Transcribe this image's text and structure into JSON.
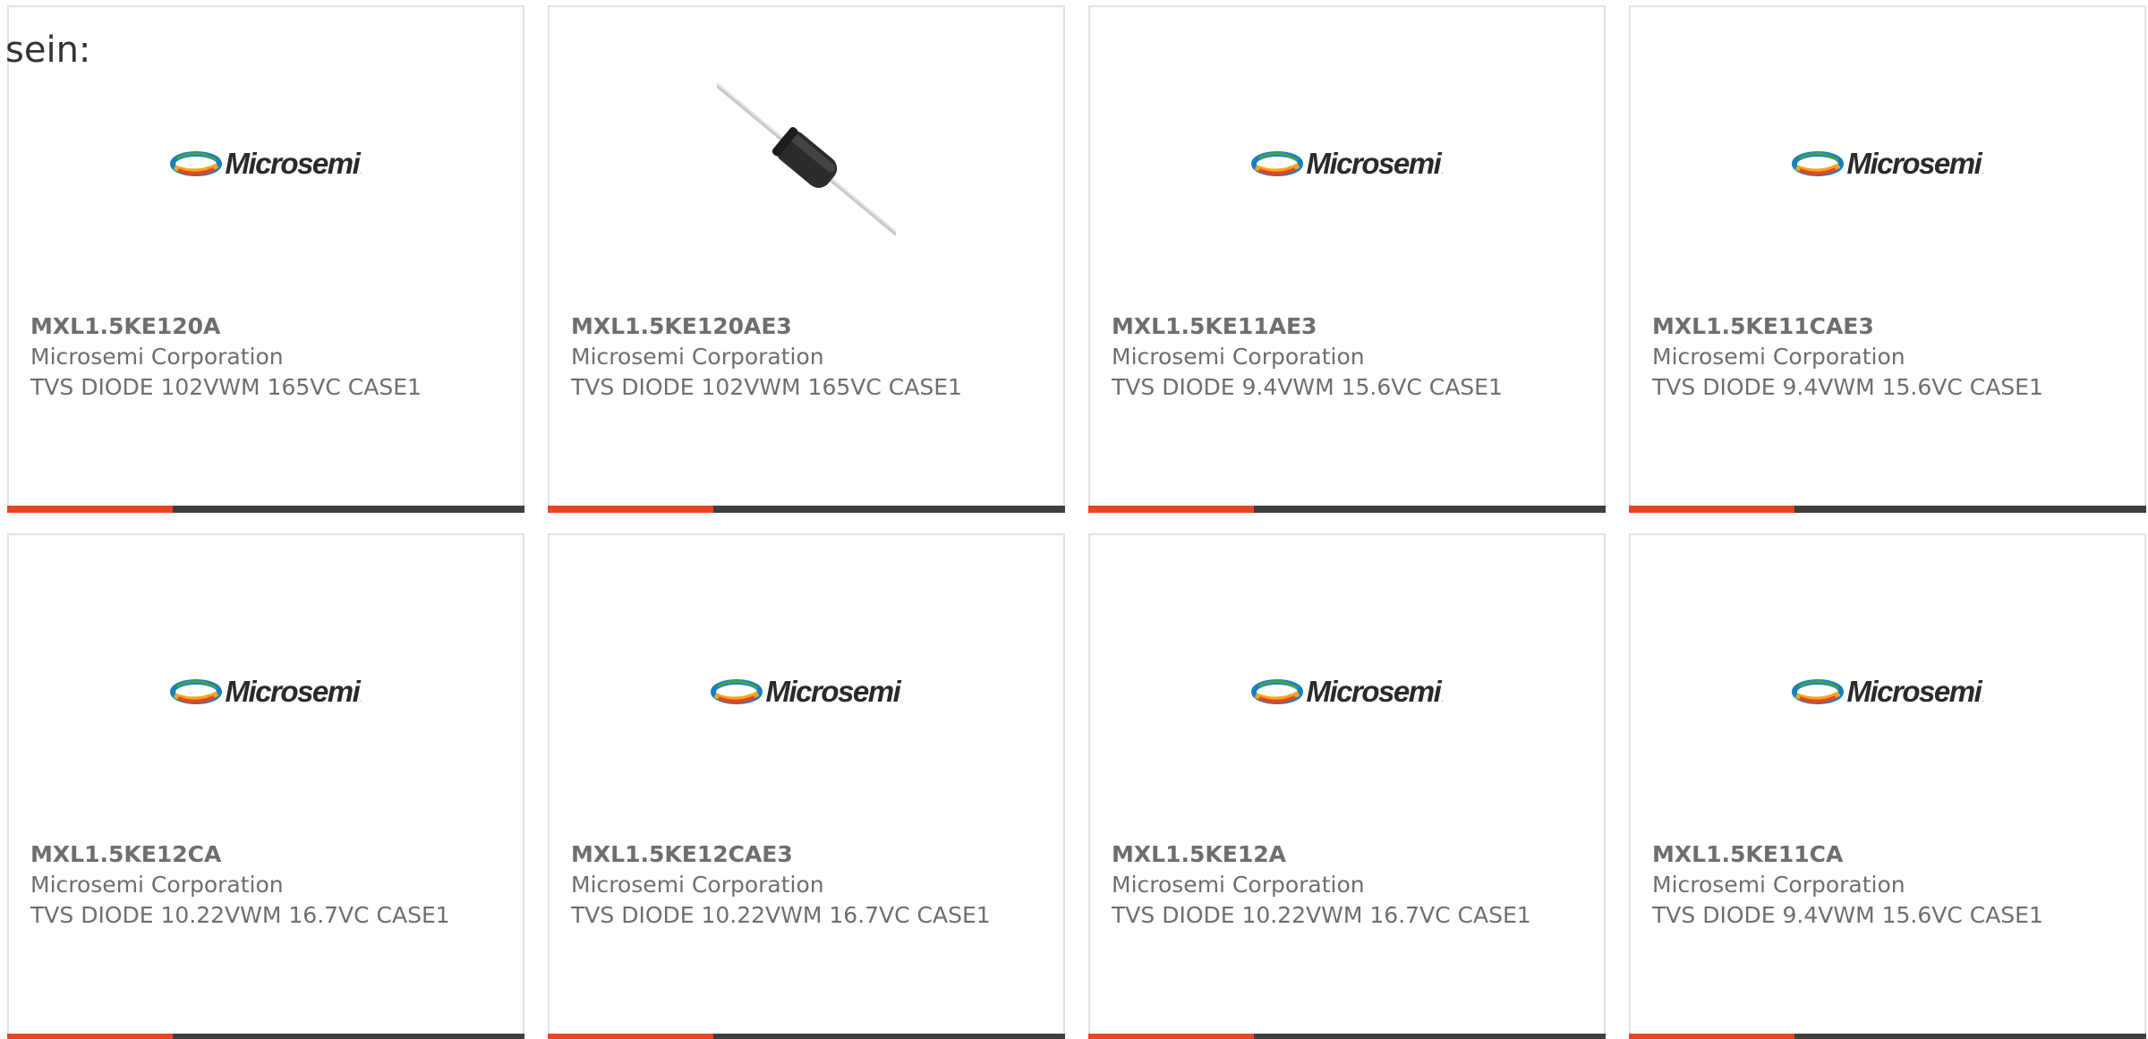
{
  "lead_text": "sein:",
  "brand_logo_text": "Microsemi",
  "brand_logo_tm": ".",
  "colors": {
    "accent": "#e8461f",
    "bar_dark": "#3f3f3f",
    "card_border": "#e2e2e2",
    "text": "#6e6e6e"
  },
  "products": [
    {
      "part_number": "MXL1.5KE120A",
      "manufacturer": "Microsemi Corporation",
      "description": "TVS DIODE 102VWM 165VC CASE1",
      "image": "microsemi-logo"
    },
    {
      "part_number": "MXL1.5KE120AE3",
      "manufacturer": "Microsemi Corporation",
      "description": "TVS DIODE 102VWM 165VC CASE1",
      "image": "diode-photo"
    },
    {
      "part_number": "MXL1.5KE11AE3",
      "manufacturer": "Microsemi Corporation",
      "description": "TVS DIODE 9.4VWM 15.6VC CASE1",
      "image": "microsemi-logo"
    },
    {
      "part_number": "MXL1.5KE11CAE3",
      "manufacturer": "Microsemi Corporation",
      "description": "TVS DIODE 9.4VWM 15.6VC CASE1",
      "image": "microsemi-logo"
    },
    {
      "part_number": "MXL1.5KE12CA",
      "manufacturer": "Microsemi Corporation",
      "description": "TVS DIODE 10.22VWM 16.7VC CASE1",
      "image": "microsemi-logo"
    },
    {
      "part_number": "MXL1.5KE12CAE3",
      "manufacturer": "Microsemi Corporation",
      "description": "TVS DIODE 10.22VWM 16.7VC CASE1",
      "image": "microsemi-logo"
    },
    {
      "part_number": "MXL1.5KE12A",
      "manufacturer": "Microsemi Corporation",
      "description": "TVS DIODE 10.22VWM 16.7VC CASE1",
      "image": "microsemi-logo"
    },
    {
      "part_number": "MXL1.5KE11CA",
      "manufacturer": "Microsemi Corporation",
      "description": "TVS DIODE 9.4VWM 15.6VC CASE1",
      "image": "microsemi-logo"
    }
  ]
}
